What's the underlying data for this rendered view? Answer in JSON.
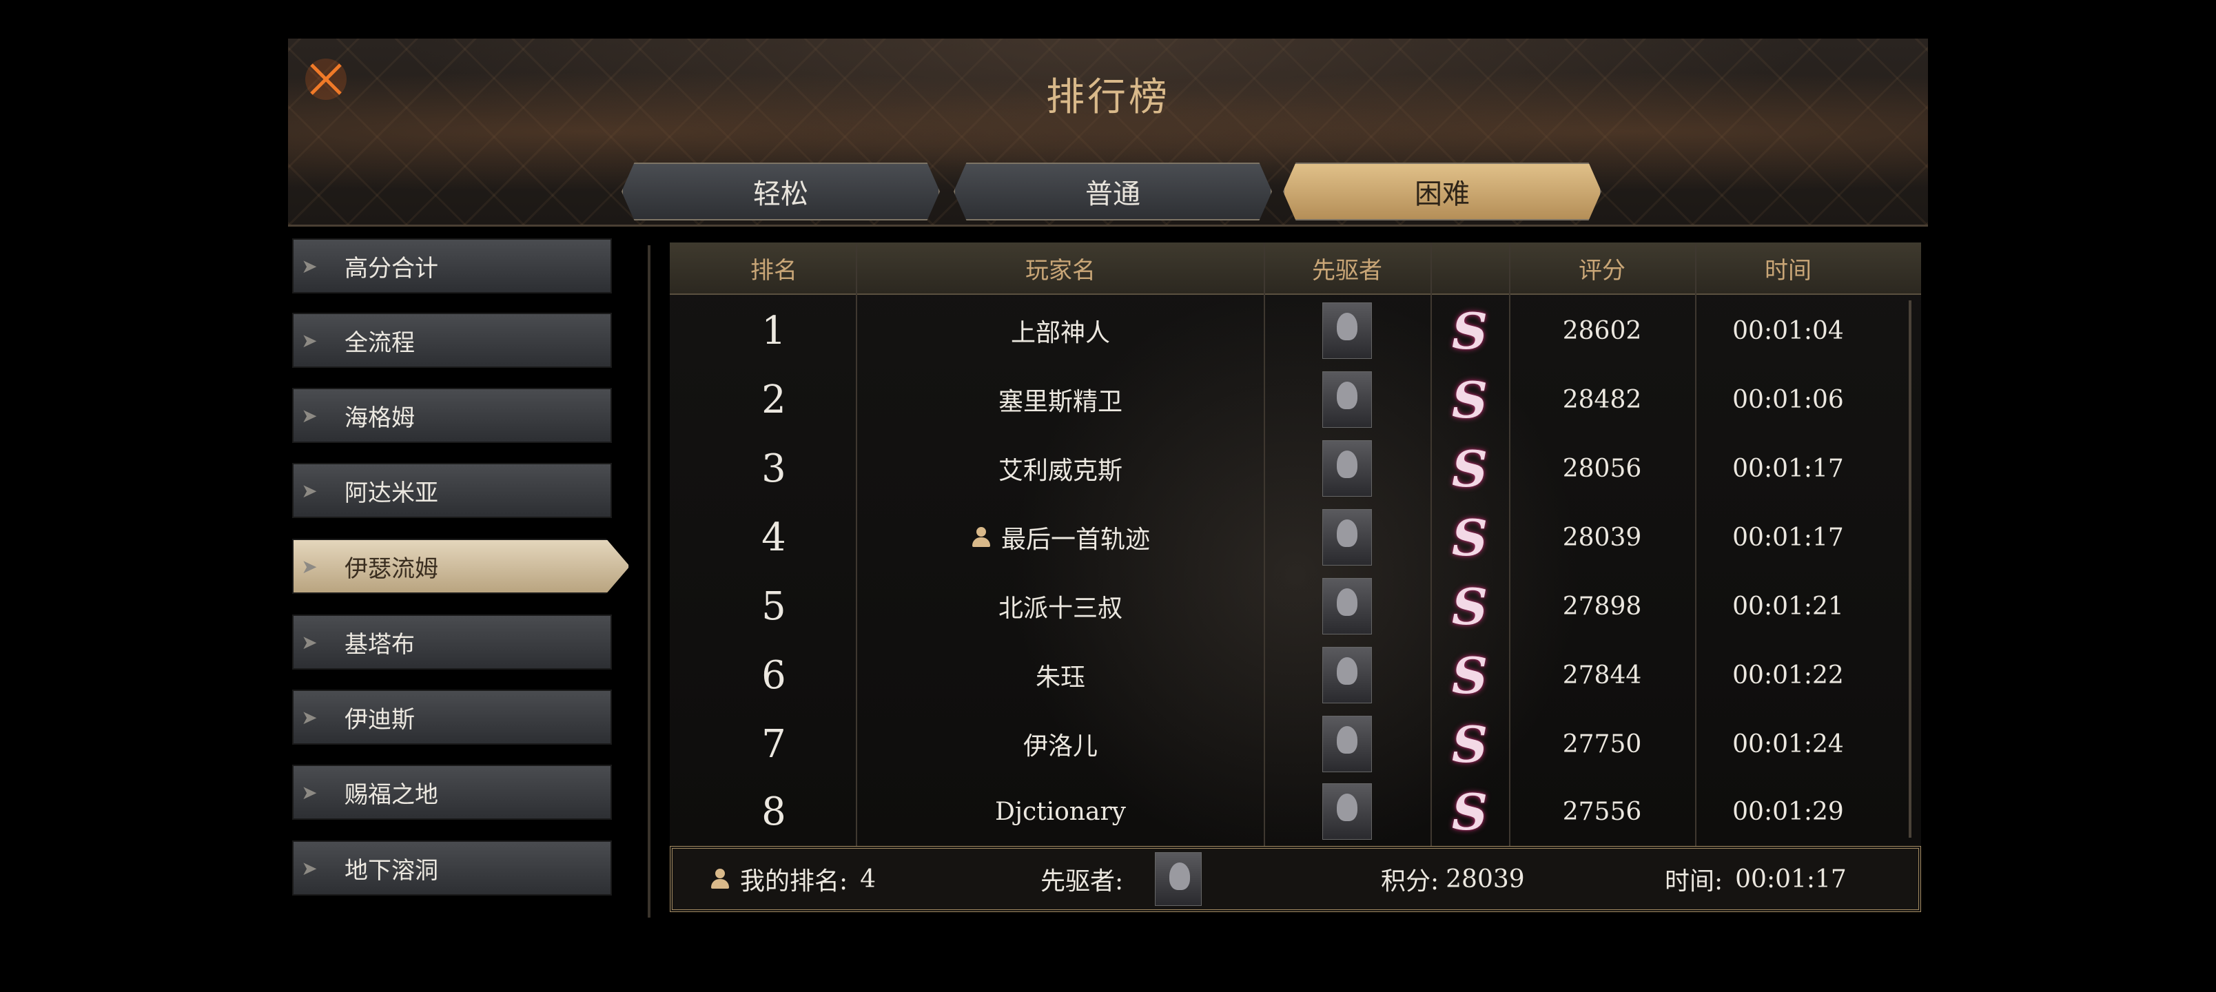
{
  "title": "排行榜",
  "tabs": [
    {
      "label": "轻松",
      "active": false
    },
    {
      "label": "普通",
      "active": false
    },
    {
      "label": "困难",
      "active": true
    }
  ],
  "sidebar": [
    {
      "label": "高分合计",
      "active": false
    },
    {
      "label": "全流程",
      "active": false
    },
    {
      "label": "海格姆",
      "active": false
    },
    {
      "label": "阿达米亚",
      "active": false
    },
    {
      "label": "伊瑟流姆",
      "active": true
    },
    {
      "label": "基塔布",
      "active": false
    },
    {
      "label": "伊迪斯",
      "active": false
    },
    {
      "label": "赐福之地",
      "active": false
    },
    {
      "label": "地下溶洞",
      "active": false
    }
  ],
  "table": {
    "headers": {
      "rank": "排名",
      "player": "玩家名",
      "pioneer": "先驱者",
      "grade": "",
      "score": "评分",
      "time": "时间"
    },
    "rows": [
      {
        "rank": "1",
        "player": "上部神人",
        "grade": "S",
        "score": "28602",
        "time": "00:01:04",
        "self": false
      },
      {
        "rank": "2",
        "player": "塞里斯精卫",
        "grade": "S",
        "score": "28482",
        "time": "00:01:06",
        "self": false
      },
      {
        "rank": "3",
        "player": "艾利威克斯",
        "grade": "S",
        "score": "28056",
        "time": "00:01:17",
        "self": false
      },
      {
        "rank": "4",
        "player": "最后一首轨迹",
        "grade": "S",
        "score": "28039",
        "time": "00:01:17",
        "self": true
      },
      {
        "rank": "5",
        "player": "北派十三叔",
        "grade": "S",
        "score": "27898",
        "time": "00:01:21",
        "self": false
      },
      {
        "rank": "6",
        "player": "朱珏",
        "grade": "S",
        "score": "27844",
        "time": "00:01:22",
        "self": false
      },
      {
        "rank": "7",
        "player": "伊洛儿",
        "grade": "S",
        "score": "27750",
        "time": "00:01:24",
        "self": false
      },
      {
        "rank": "8",
        "player": "Djctionary",
        "grade": "S",
        "score": "27556",
        "time": "00:01:29",
        "self": false
      }
    ]
  },
  "footer": {
    "my_rank_label": "我的排名:",
    "my_rank_value": "4",
    "pioneer_label": "先驱者:",
    "score_label": "积分:",
    "score_value": "28039",
    "time_label": "时间:",
    "time_value": "00:01:17"
  },
  "colors": {
    "accent": "#d9b98a",
    "active_tab": "#c9a36b",
    "grade_glow": "#b0306a"
  },
  "icons": {
    "close": "close-x-icon",
    "self": "person-icon",
    "avatar": "pioneer-avatar-icon"
  }
}
